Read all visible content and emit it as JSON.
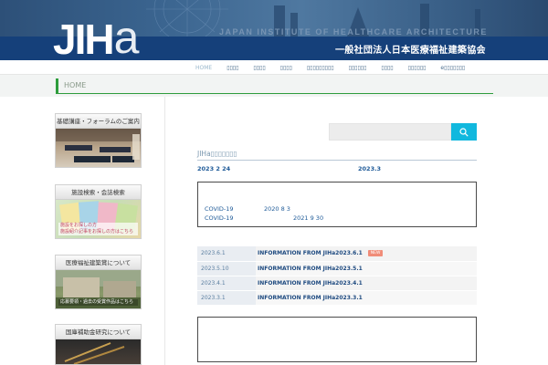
{
  "header": {
    "logo_main": "JIH",
    "logo_accent": "a",
    "institute_en": "JAPAN INSTITUTE OF HEALTHCARE ARCHITECTURE",
    "institute_jp": "一般社団法人日本医療福祉建築協会"
  },
  "nav": {
    "items": [
      {
        "label": "HOME"
      },
      {
        "label": "▯▯▯▯"
      },
      {
        "label": "▯▯▯▯"
      },
      {
        "label": "▯▯▯▯"
      },
      {
        "label": "▯▯▯▯▯▯▯▯▯"
      },
      {
        "label": "▯▯▯▯▯▯"
      },
      {
        "label": "▯▯▯▯"
      },
      {
        "label": "▯▯▯▯▯▯"
      },
      {
        "label": "e▯▯▯▯▯▯▯"
      }
    ]
  },
  "breadcrumb": {
    "label": "HOME"
  },
  "sidebar": {
    "banners": [
      {
        "title": "基礎講座・フォーラムのご案内",
        "overlay": ""
      },
      {
        "title": "施設検索・会誌検索",
        "overlay": "施設をお探しの方\n施設紹介記事をお探しの方はこちら"
      },
      {
        "title": "医療福祉建築賞について",
        "overlay": "応募要領・過去の受賞作品はこちら"
      },
      {
        "title": "国庫補助金研究について",
        "overlay": ""
      }
    ]
  },
  "search": {
    "placeholder": ""
  },
  "main": {
    "section_title": "JIHa▯▯▯▯▯▯▯",
    "date_left": "2023  2  24",
    "date_right": "2023.3",
    "covid": [
      {
        "label": "COVID-19",
        "date": "2020  8  3"
      },
      {
        "label": "COVID-19",
        "date": "2021  9  30"
      }
    ]
  },
  "news": [
    {
      "date": "2023.6.1",
      "title": "INFORMATION FROM JIHa2023.6.1",
      "badge": "NEW"
    },
    {
      "date": "2023.5.10",
      "title": "INFORMATION FROM JIHa2023.5.1",
      "badge": ""
    },
    {
      "date": "2023.4.1",
      "title": "INFORMATION FROM JIHa2023.4.1",
      "badge": ""
    },
    {
      "date": "2023.3.1",
      "title": "INFORMATION FROM JIHa2023.3.1",
      "badge": ""
    }
  ],
  "colors": {
    "header_band": "#15407a",
    "accent_green": "#2e9d3c",
    "search_button": "#11b8de",
    "link_blue": "#1e4a80",
    "new_badge": "#f08c78"
  }
}
